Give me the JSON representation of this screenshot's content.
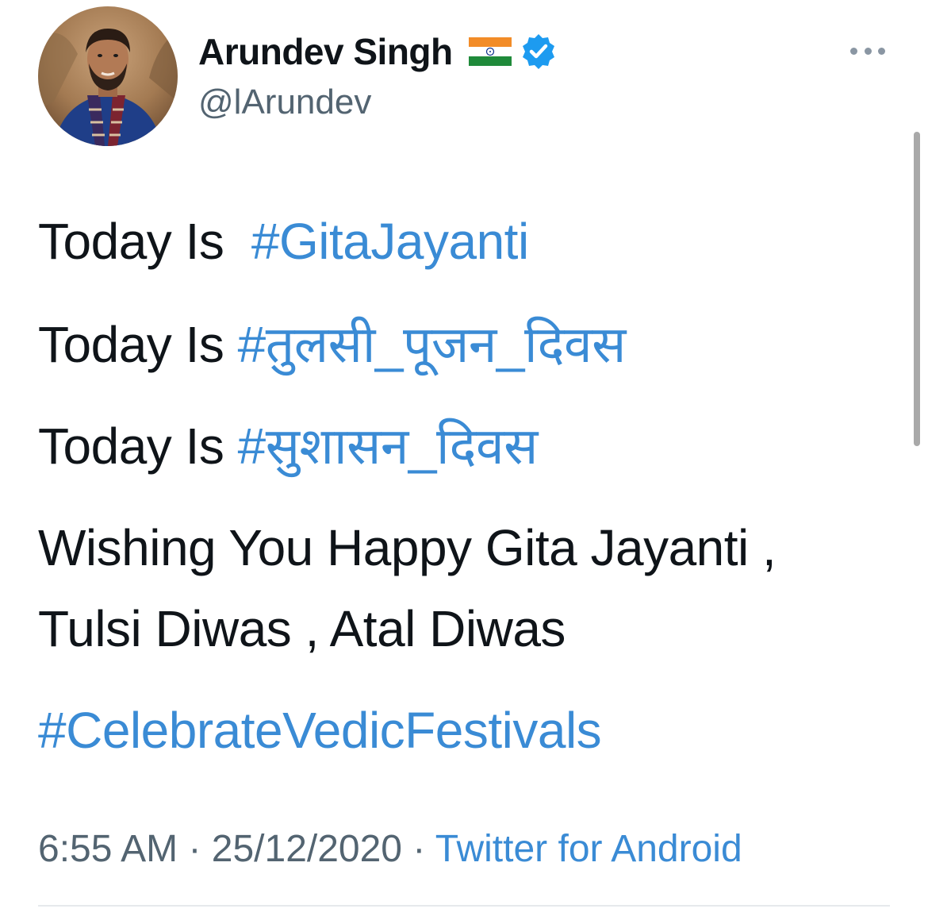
{
  "tweet": {
    "author": {
      "display_name": "Arundev Singh",
      "flag_emoji": "india-flag-icon",
      "handle": "@lArundev",
      "verified": true
    },
    "more_icon": "more-options-icon",
    "lines": [
      {
        "prefix": "Today Is  ",
        "hashtag": "#GitaJayanti"
      },
      {
        "prefix": "Today Is ",
        "hashtag": "#तुलसी_पूजन_दिवस"
      },
      {
        "prefix": "Today Is ",
        "hashtag": "#सुशासन_दिवस"
      }
    ],
    "message_line1": "Wishing You Happy Gita Jayanti ,",
    "message_line2": "Tulsi Diwas , Atal Diwas",
    "closing_hashtag": "#CelebrateVedicFestivals",
    "time": "6:55 AM",
    "separator": " · ",
    "date": "25/12/2020",
    "source": "Twitter for Android"
  },
  "colors": {
    "link": "#3a8bd5",
    "text": "#0f1419",
    "secondary": "#536471",
    "verified": "#1d9bf0"
  }
}
